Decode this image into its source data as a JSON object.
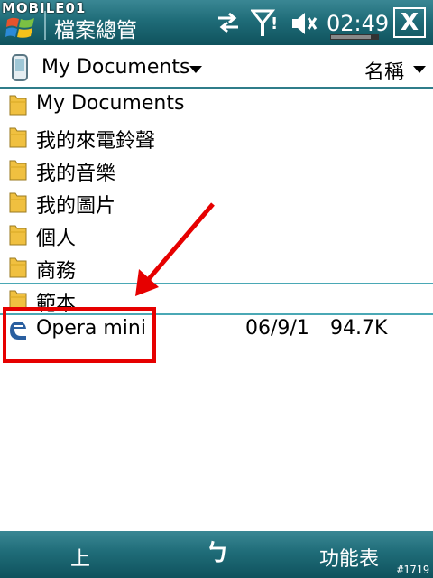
{
  "watermark": "MOBILE01",
  "titlebar": {
    "app_title": "檔案總管",
    "clock": "02:49",
    "close_label": "X"
  },
  "folder_header": {
    "current_folder": "My Documents",
    "sort_by": "名稱"
  },
  "files": [
    {
      "name": "My Documents",
      "type": "folder"
    },
    {
      "name": "我的來電鈴聲",
      "type": "folder"
    },
    {
      "name": "我的音樂",
      "type": "folder"
    },
    {
      "name": "我的圖片",
      "type": "folder"
    },
    {
      "name": "個人",
      "type": "folder"
    },
    {
      "name": "商務",
      "type": "folder"
    },
    {
      "name": "範本",
      "type": "folder"
    },
    {
      "name": "Opera mini",
      "type": "file",
      "date": "06/9/1",
      "size": "94.7K"
    }
  ],
  "softkeys": {
    "left": "上",
    "middle": "ㄅ",
    "right": "功能表"
  },
  "screenshot_id": "#1719",
  "colors": {
    "bar": "#1f6c78",
    "annotation": "#e60000",
    "selection": "#4aa8b5",
    "folder": "#f0c040"
  }
}
